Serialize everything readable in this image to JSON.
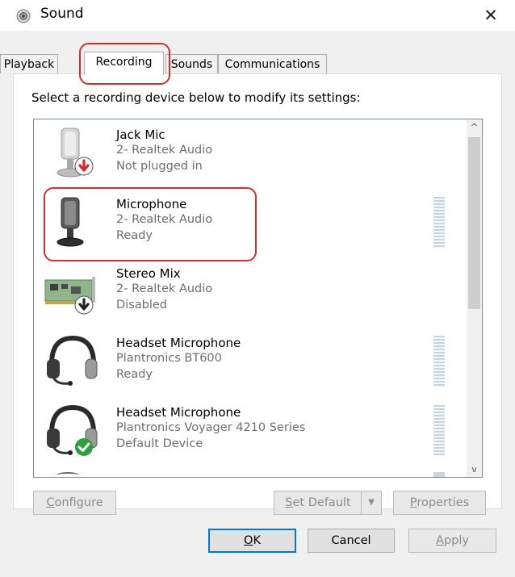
{
  "window": {
    "title": "Sound",
    "close_glyph": "✕"
  },
  "tabs": [
    {
      "label": "Playback",
      "active": false
    },
    {
      "label": "Recording",
      "active": true
    },
    {
      "label": "Sounds",
      "active": false
    },
    {
      "label": "Communications",
      "active": false
    }
  ],
  "instruction": "Select a recording device below to modify its settings:",
  "devices": [
    {
      "name": "Jack Mic",
      "driver": "2- Realtek Audio",
      "status": "Not plugged in",
      "icon": "microphone-icon",
      "badge": "red-down-arrow",
      "level_meter": false
    },
    {
      "name": "Microphone",
      "driver": "2- Realtek Audio",
      "status": "Ready",
      "icon": "microphone-icon",
      "badge": "none",
      "level_meter": true
    },
    {
      "name": "Stereo Mix",
      "driver": "2- Realtek Audio",
      "status": "Disabled",
      "icon": "sound-card-icon",
      "badge": "black-down-arrow",
      "level_meter": false
    },
    {
      "name": "Headset Microphone",
      "driver": "Plantronics BT600",
      "status": "Ready",
      "icon": "headset-icon",
      "badge": "none",
      "level_meter": true
    },
    {
      "name": "Headset Microphone",
      "driver": "Plantronics Voyager 4210 Series",
      "status": "Default Device",
      "icon": "headset-icon",
      "badge": "green-check",
      "level_meter": true
    }
  ],
  "scrollbar": {
    "up_glyph": "^",
    "down_glyph": "v"
  },
  "buttons": {
    "configure": {
      "first": "C",
      "rest": "onfigure"
    },
    "set_default": {
      "first": "S",
      "rest": "et Default",
      "arrow": "▼"
    },
    "properties": {
      "first": "P",
      "rest": "roperties"
    },
    "ok": {
      "pre": "",
      "key": "O",
      "post": "K"
    },
    "cancel": "Cancel",
    "apply": {
      "first": "A",
      "rest": "pply"
    }
  },
  "colors": {
    "highlight": "#d32f2f",
    "accent": "#0078d7",
    "meter": "#c6d3e0",
    "check": "#2e9e3e",
    "alert": "#d62828"
  }
}
